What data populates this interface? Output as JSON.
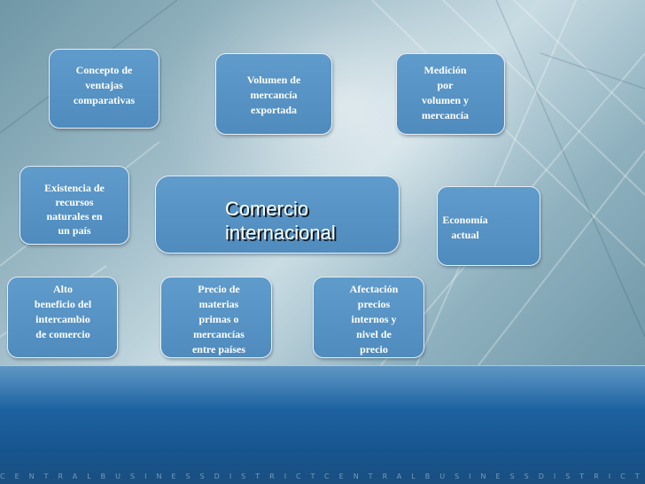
{
  "slide": {
    "title": "Comercio\ninternacional",
    "footer": "CENTRALBUSINESSDISTRICTCENTRALBUSINESSDISTRICTCENTRA",
    "nodes": {
      "concepto": "Concepto de\nventajas\ncomparativas",
      "volumen": "Volumen de\nmercancía\nexportada",
      "medicion": "Medición\npor\nvolumen y\nmercancía",
      "existencia": "Existencia de\nrecursos\nnaturales en\nun país",
      "economia": "Economía\nactual",
      "alto": "Alto\nbeneficio del\nintercambio\nde comercio",
      "precio": "Precio de\nmaterias\nprimas o\nmercancías\nentre países",
      "afectacion": "Afectación\nprecios\ninternos y\nnivel de\nprecio"
    }
  },
  "colors": {
    "box_fill": "#5a96c7",
    "box_border": "#e8eef4",
    "band": "#1e63a2",
    "background": "#9fbcc8"
  }
}
